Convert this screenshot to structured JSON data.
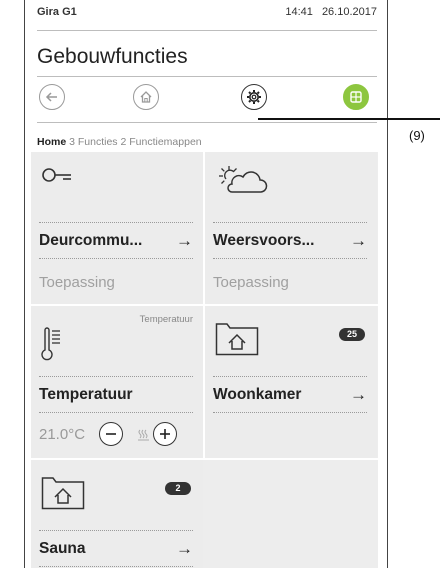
{
  "statusbar": {
    "device_name": "Gira G1",
    "time": "14:41",
    "date": "26.10.2017"
  },
  "page": {
    "title": "Gebouwfuncties"
  },
  "navbar": {
    "buttons": [
      {
        "name": "back",
        "icon": "back-arrow-icon"
      },
      {
        "name": "home",
        "icon": "home-icon"
      },
      {
        "name": "settings",
        "icon": "gear-icon"
      },
      {
        "name": "tile-view",
        "icon": "grid-icon",
        "active": true,
        "color": "#8dc63f"
      }
    ]
  },
  "breadcrumb": {
    "home": "Home",
    "functions_count": "3",
    "functions_label": "Functies",
    "folders_count": "2",
    "folders_label": "Functiemappen"
  },
  "tiles": [
    {
      "icon": "key-icon",
      "name": "Deurcommu...",
      "arrow": "→",
      "subtitle": "Toepassing"
    },
    {
      "icon": "weather-icon",
      "name": "Weersvoors...",
      "arrow": "→",
      "subtitle": "Toepassing"
    },
    {
      "icon": "thermometer-icon",
      "corner_label": "Temperatuur",
      "name": "Temperatuur",
      "value": "21.0°C"
    },
    {
      "icon": "folder-home-icon",
      "badge": "25",
      "name": "Woonkamer",
      "arrow": "→"
    },
    {
      "icon": "folder-home-icon",
      "badge": "2",
      "name": "Sauna",
      "arrow": "→"
    }
  ],
  "callout": {
    "label": "(9)"
  }
}
